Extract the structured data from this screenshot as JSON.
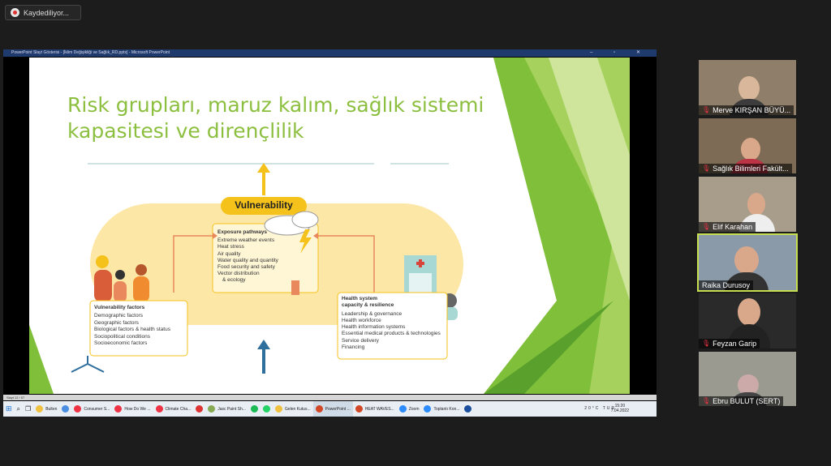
{
  "recording": {
    "label": "Kaydediliyor..."
  },
  "window": {
    "title": "PowerPoint Slayt Gösterisi - [İklim Değişikliği ve Sağlık_RD.pptx] - Microsoft PowerPoint",
    "controls": "–  ▫  ✕"
  },
  "slide": {
    "title_line1": "Risk grupları, maruz kalım, sağlık sistemi",
    "title_line2": "kapasitesi ve dirençlilik",
    "diagram": {
      "vulnerability": "Vulnerability",
      "exposure_title": "Exposure pathways",
      "exposure_items": [
        "Extreme weather events",
        "Heat stress",
        "Air quality",
        "Water quality and quantity",
        "Food security and safety",
        "Vector distribution",
        "& ecology"
      ],
      "factors_title": "Vulnerability factors",
      "factors_items": [
        "Demographic factors",
        "Geographic factors",
        "Biological factors & health status",
        "Sociopolitical conditions",
        "Socioeconomic factors"
      ],
      "health_title1": "Health system",
      "health_title2": "capacity & resilience",
      "health_items": [
        "Leadership & governance",
        "Health workforce",
        "Health information systems",
        "Essential medical products & technologies",
        "Service delivery",
        "Financing"
      ]
    }
  },
  "statusbar": {
    "text": "Slayt 12 / 57"
  },
  "taskbar": {
    "items": [
      "Bulten",
      "Consumer S...",
      "How Do We ...",
      "Climate Cha...",
      "",
      "Jasc Paint Sh...",
      "",
      "",
      "Gelen Kutus...",
      "PowerPoint ...",
      "HEAT WAVES...",
      "Zoom",
      "Toplantı Kon..."
    ],
    "temperature": "20°C",
    "lang": "TUR",
    "time": "15:20",
    "date": "7.04.2022"
  },
  "participants": [
    {
      "name": "Merve KIRŞAN BÜYÜ...",
      "muted": true
    },
    {
      "name": "Sağlık Bilimleri Fakült...",
      "muted": true
    },
    {
      "name": "Elif Karahan",
      "muted": true
    },
    {
      "name": "Raika Durusoy",
      "muted": false
    },
    {
      "name": "Feyzan Garip",
      "muted": true
    },
    {
      "name": "Ebru BULUT (SERT)",
      "muted": true
    }
  ],
  "colors": {
    "accent_green": "#8cbf3f",
    "diagram_yellow": "#f5c21b",
    "active_speaker": "#c5dd4f",
    "arrow_blue": "#2e6f9e"
  }
}
